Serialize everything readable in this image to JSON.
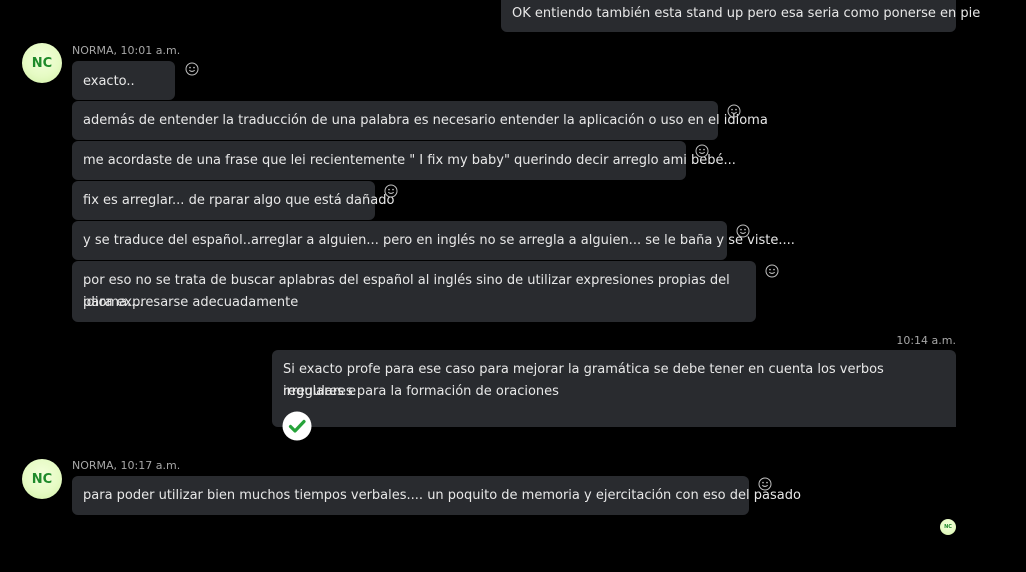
{
  "colors": {
    "background": "#000000",
    "bubble": "#292b2f",
    "accent_green": "#26a33a",
    "avatar_bg": "#e6fbc4",
    "avatar_text": "#1f8a2a"
  },
  "messages": {
    "top_outgoing": "OK entiendo también esta stand up pero esa seria como ponerse en pie",
    "group1": {
      "avatar": "NC",
      "sender": "NORMA, 10:01 a.m.",
      "items": [
        "exacto..",
        "además de entender la traducción de una palabra es necesario entender la aplicación o uso en el idioma",
        "me acordaste de una frase que lei recientemente \" I fix my baby\" querindo decir arreglo ami bebé...",
        "fix es arreglar... de rparar algo que está dañado",
        "y se traduce del español..arreglar a alguien... pero en inglés no se arregla a alguien... se le baña y se viste....",
        "por eso no se trata de buscar aplabras del español al inglés sino de utilizar expresiones propias del idioma....",
        "para expresarse adecuadamente"
      ]
    },
    "outgoing2": {
      "time": "10:14 a.m.",
      "line1": "Si exacto profe para ese caso para mejorar la gramática se debe tener en cuenta los verbos regulares e",
      "line2": "irregulares para la formación de oraciones",
      "status_icon": "checkmark-icon"
    },
    "group2": {
      "avatar": "NC",
      "sender": "NORMA, 10:17 a.m.",
      "text": "para poder utilizar bien muchos tiempos verbales.... un poquito de memoria y ejercitación con eso del pasado"
    },
    "read_receipt_avatar": "NC"
  },
  "icons": {
    "reaction": "smiley-icon",
    "sent": "checkmark-icon"
  }
}
